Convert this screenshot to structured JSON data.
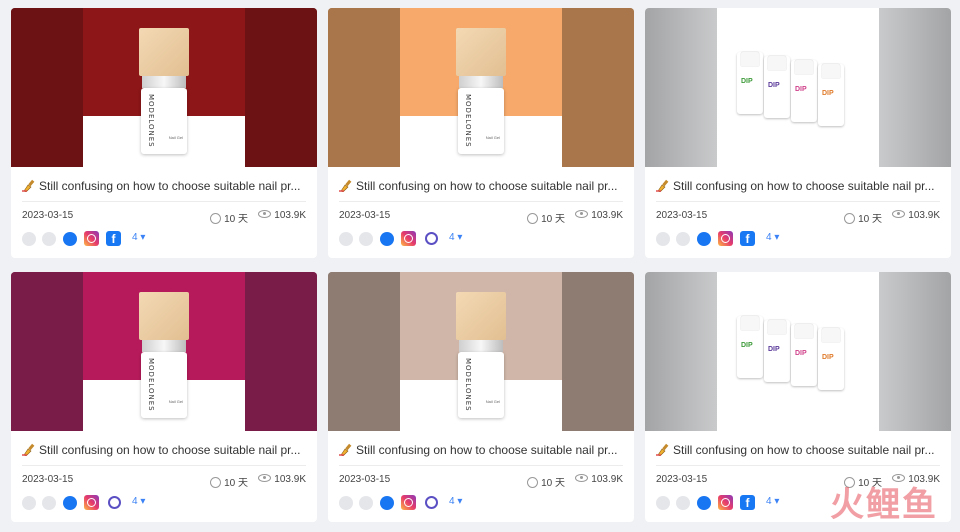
{
  "cards": [
    {
      "title": "Still confusing on how to choose suitable nail pr...",
      "date": "2023-03-15",
      "duration": "10 天",
      "views": "103.9K",
      "extra_count": "4",
      "platform_set": "a",
      "product": "bottle",
      "bg": "#8c1618",
      "bg_side": "#6c1214"
    },
    {
      "title": "Still confusing on how to choose suitable nail pr...",
      "date": "2023-03-15",
      "duration": "10 天",
      "views": "103.9K",
      "extra_count": "4",
      "platform_set": "b",
      "product": "bottle",
      "bg": "#f6a96a",
      "bg_side": "#a8764a"
    },
    {
      "title": "Still confusing on how to choose suitable nail pr...",
      "date": "2023-03-15",
      "duration": "10 天",
      "views": "103.9K",
      "extra_count": "4",
      "platform_set": "c",
      "product": "dip",
      "bg": "#ffffff",
      "bg_side": "#a3a4a6"
    },
    {
      "title": "Still confusing on how to choose suitable nail pr...",
      "date": "2023-03-15",
      "duration": "10 天",
      "views": "103.9K",
      "extra_count": "4",
      "platform_set": "b",
      "product": "bottle",
      "bg": "#b71a5a",
      "bg_side": "#7a1c48"
    },
    {
      "title": "Still confusing on how to choose suitable nail pr...",
      "date": "2023-03-15",
      "duration": "10 天",
      "views": "103.9K",
      "extra_count": "4",
      "platform_set": "b",
      "product": "bottle",
      "bg": "#cfb6a8",
      "bg_side": "#8e7c72"
    },
    {
      "title": "Still confusing on how to choose suitable nail pr...",
      "date": "2023-03-15",
      "duration": "10 天",
      "views": "103.9K",
      "extra_count": "4",
      "platform_set": "c",
      "product": "dip",
      "bg": "#ffffff",
      "bg_side": "#a3a4a6"
    }
  ],
  "product_brand": "MODELONES",
  "product_label": "Nail Gel",
  "dip_label": "DIP",
  "watermark": "火鲤鱼",
  "icons": {
    "title_emoji": "nail-polish-emoji",
    "duration": "clock-icon",
    "views": "eye-icon"
  },
  "colors": {
    "accent_count": "#3b82f6",
    "messenger": "#1976f2",
    "facebook": "#1877f2"
  }
}
